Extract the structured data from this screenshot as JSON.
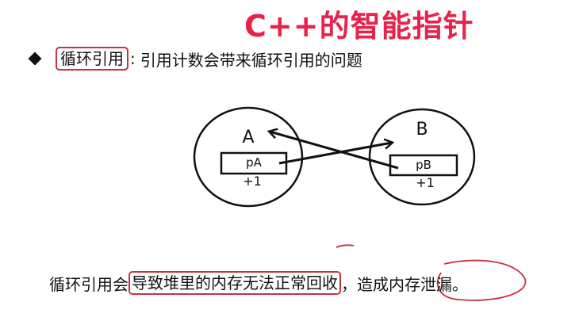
{
  "slide": {
    "title": "C++的智能指针",
    "bullet": {
      "highlight": "循环引用",
      "colon": ":",
      "rest": "引用计数会带来循环引用的问题"
    },
    "diagram": {
      "node_a": {
        "label": "A",
        "pointer": "pA",
        "count": "+1"
      },
      "node_b": {
        "label": "B",
        "pointer": "pB",
        "count": "+1"
      }
    },
    "conclusion": {
      "part1": "循环引用会",
      "part2": "导致堆里的内存无法正常回收",
      "part3": "，造成内存泄漏。"
    },
    "colors": {
      "title": "#e8234a",
      "annotation": "#c8313f",
      "ink": "#111111"
    }
  }
}
